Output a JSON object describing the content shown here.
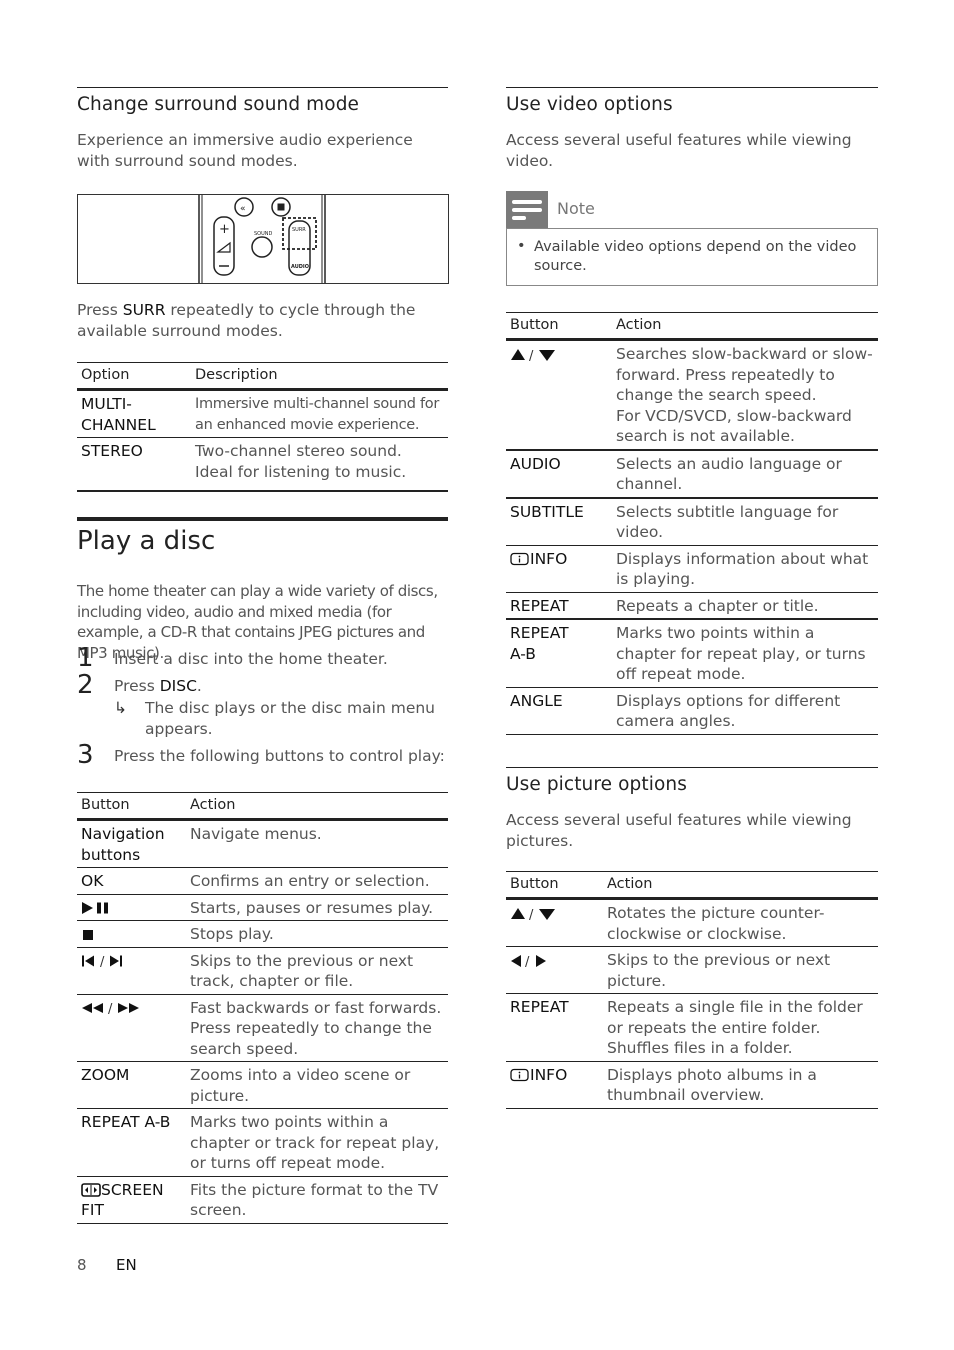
{
  "left": {
    "surround": {
      "title": "Change surround sound mode",
      "intro": "Experience an immersive audio experience with surround sound modes.",
      "remote_labels": {
        "sound": "SOUND",
        "surr": "SURR",
        "audio": "AUDIO"
      },
      "instruction_pre": "Press ",
      "instruction_key": "SURR",
      "instruction_post": " repeatedly to cycle through the available surround modes.",
      "table": {
        "headers": [
          "Option",
          "Description"
        ],
        "rows": [
          {
            "option": "MULTI-CHANNEL",
            "option_l1": "MULTI-",
            "option_l2": "CHANNEL",
            "description": "Immersive multi-channel sound for an enhanced movie experience."
          },
          {
            "option": "STEREO",
            "description": "Two-channel stereo sound. Ideal for listening to music."
          }
        ]
      }
    },
    "play_disc": {
      "title": "Play a disc",
      "intro": "The home theater can play a wide variety of discs, including video, audio and mixed media (for example, a CD-R that contains JPEG pictures and MP3 music).",
      "steps": [
        {
          "num": "1",
          "text": "Insert a disc into the home theater."
        },
        {
          "num": "2",
          "text_pre": "Press ",
          "key": "DISC",
          "text_post": ".",
          "result_arrow": "↳",
          "result": "The disc plays or the disc main menu appears."
        },
        {
          "num": "3",
          "text": "Press the following buttons to control play:"
        }
      ],
      "table": {
        "headers": [
          "Button",
          "Action"
        ],
        "rows": [
          {
            "button": "Navigation buttons",
            "action": "Navigate menus."
          },
          {
            "button": "OK",
            "action": "Confirms an entry or selection."
          },
          {
            "button": "▶❚❚",
            "icon": "play-pause-icon",
            "action": "Starts, pauses or resumes play."
          },
          {
            "button": "■",
            "icon": "stop-icon",
            "action": "Stops play."
          },
          {
            "button": "|◀ / ▶|",
            "icon": "skip-prev-next-icon",
            "action": "Skips to the previous or next track, chapter or file."
          },
          {
            "button": "◀◀ / ▶▶",
            "icon": "rewind-forward-icon",
            "action": "Fast backwards or fast forwards. Press repeatedly to change the search speed."
          },
          {
            "button": "ZOOM",
            "action": "Zooms into a video scene or picture."
          },
          {
            "button": "REPEAT A-B",
            "action": "Marks two points within a chapter or track for repeat play, or turns off repeat mode."
          },
          {
            "button": "SCREEN FIT",
            "icon": "screen-fit-icon",
            "action": "Fits the picture format to the TV screen."
          }
        ]
      }
    }
  },
  "right": {
    "video": {
      "title": "Use video options",
      "intro": "Access several useful features while viewing video.",
      "note": {
        "label": "Note",
        "items": [
          "Available video options depend on the video source."
        ]
      },
      "table": {
        "headers": [
          "Button",
          "Action"
        ],
        "rows": [
          {
            "button": "▲ / ▼",
            "icon": "up-down-icon",
            "action": "Searches slow-backward or slow-forward. Press repeatedly to change the search speed.",
            "action2": "For VCD/SVCD, slow-backward search is not available."
          },
          {
            "button": "AUDIO",
            "action": "Selects an audio language or channel."
          },
          {
            "button": "SUBTITLE",
            "action": "Selects subtitle language for video."
          },
          {
            "button": "INFO",
            "icon": "info-icon",
            "action": "Displays information about what is playing."
          },
          {
            "button": "REPEAT",
            "action": "Repeats a chapter or title."
          },
          {
            "button": "REPEAT A-B",
            "button_l1": "REPEAT",
            "button_l2": "A-B",
            "action": "Marks two points within a chapter for repeat play, or turns off repeat mode."
          },
          {
            "button": "ANGLE",
            "action": "Displays options for different camera angles."
          }
        ]
      }
    },
    "picture": {
      "title": "Use picture options",
      "intro": "Access several useful features while viewing pictures.",
      "table": {
        "headers": [
          "Button",
          "Action"
        ],
        "rows": [
          {
            "button": "▲ / ▼",
            "icon": "up-down-icon",
            "action": "Rotates the picture counter-clockwise or clockwise."
          },
          {
            "button": "◀ / ▶",
            "icon": "left-right-icon",
            "action": "Skips to the previous or next picture."
          },
          {
            "button": "REPEAT",
            "action": "Repeats a single file in the folder or repeats the entire folder.",
            "action2": "Shuffles files in a folder."
          },
          {
            "button": "INFO",
            "icon": "info-icon",
            "action": "Displays photo albums in a thumbnail overview."
          }
        ]
      }
    }
  },
  "footer": {
    "page": "8",
    "lang": "EN"
  }
}
